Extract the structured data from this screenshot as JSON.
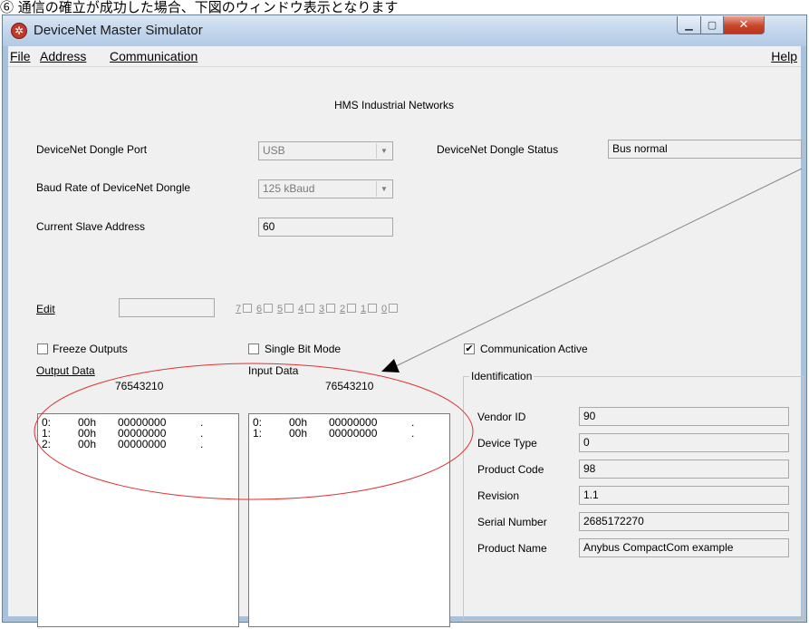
{
  "caption": "⑥ 通信の確立が成功した場合、下図のウィンドウ表示となります",
  "window": {
    "title": "DeviceNet Master Simulator"
  },
  "menu": {
    "file": "File",
    "address": "Address",
    "communication": "Communication",
    "help": "Help"
  },
  "vendor_header": "HMS Industrial Networks",
  "dongle_port": {
    "label": "DeviceNet Dongle Port",
    "value": "USB"
  },
  "dongle_status": {
    "label": "DeviceNet Dongle Status",
    "value": "Bus normal"
  },
  "baud_rate": {
    "label": "Baud Rate of DeviceNet Dongle",
    "value": "125 kBaud"
  },
  "slave_address": {
    "label": "Current Slave Address",
    "value": "60"
  },
  "edit": {
    "label": "Edit",
    "value": "",
    "bits": [
      "7",
      "6",
      "5",
      "4",
      "3",
      "2",
      "1",
      "0"
    ]
  },
  "options": {
    "freeze_outputs": {
      "label": "Freeze Outputs",
      "checked": false
    },
    "single_bit_mode": {
      "label": "Single Bit Mode",
      "checked": false
    },
    "communication_active": {
      "label": "Communication Active",
      "checked": true
    }
  },
  "output_data": {
    "title": "Output Data",
    "bit_header": "76543210",
    "rows": [
      {
        "index": "0:",
        "hex": "00h",
        "bin": "00000000",
        "ascii": "."
      },
      {
        "index": "1:",
        "hex": "00h",
        "bin": "00000000",
        "ascii": "."
      },
      {
        "index": "2:",
        "hex": "00h",
        "bin": "00000000",
        "ascii": "."
      }
    ]
  },
  "input_data": {
    "title": "Input Data",
    "bit_header": "76543210",
    "rows": [
      {
        "index": "0:",
        "hex": "00h",
        "bin": "00000000",
        "ascii": "."
      },
      {
        "index": "1:",
        "hex": "00h",
        "bin": "00000000",
        "ascii": "."
      }
    ]
  },
  "identification": {
    "title": "Identification",
    "fields": [
      {
        "label": "Vendor ID",
        "value": "90"
      },
      {
        "label": "Device Type",
        "value": "0"
      },
      {
        "label": "Product Code",
        "value": "98"
      },
      {
        "label": "Revision",
        "value": "1.1"
      },
      {
        "label": "Serial Number",
        "value": "2685172270"
      },
      {
        "label": "Product Name",
        "value": "Anybus CompactCom example"
      }
    ]
  },
  "colors": {
    "annotation_red": "#e03030",
    "title_bar": "#c2d6ec",
    "close_button": "#c9462c",
    "dialog_bg": "#f0f0f0"
  },
  "icons": {
    "app": "devicenet-app-icon",
    "check": "checkmark-icon",
    "dropdown": "chevron-down-icon"
  }
}
